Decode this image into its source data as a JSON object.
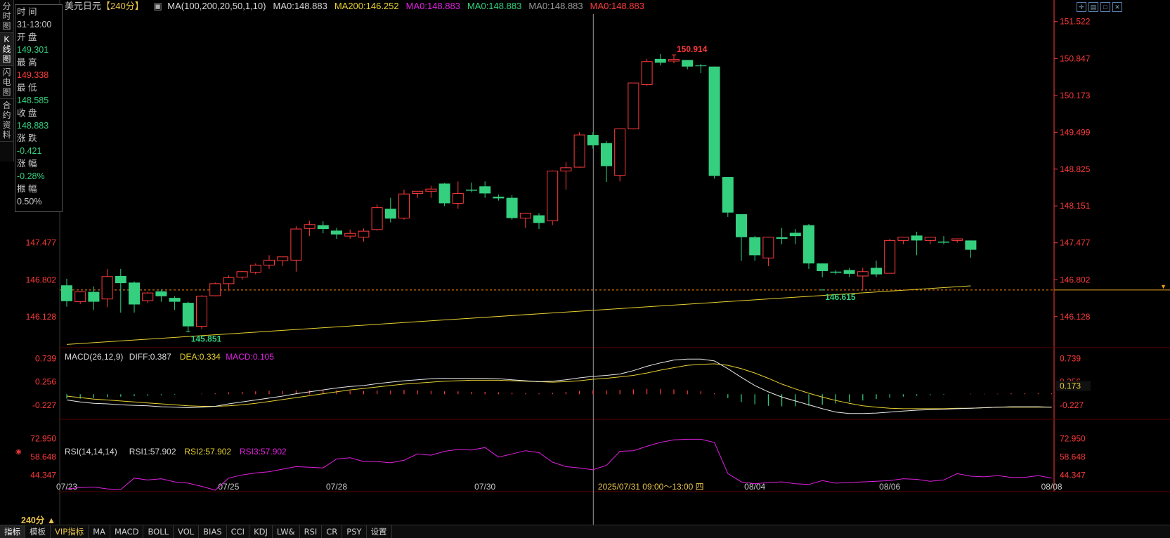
{
  "sidebar": {
    "items": [
      {
        "label": "分时图",
        "active": false
      },
      {
        "label": "K线图",
        "active": true
      },
      {
        "label": "闪电图",
        "active": false
      },
      {
        "label": "合约资料",
        "active": false
      }
    ]
  },
  "infobox": {
    "fields": [
      {
        "label": "时 间",
        "value": "31-13:00",
        "color": "#c8c8c8"
      },
      {
        "label": "开 盘",
        "value": "149.301",
        "color": "#35d07f"
      },
      {
        "label": "最 高",
        "value": "149.338",
        "color": "#ff3b3b"
      },
      {
        "label": "最 低",
        "value": "148.585",
        "color": "#35d07f"
      },
      {
        "label": "收 盘",
        "value": "148.883",
        "color": "#35d07f"
      },
      {
        "label": "涨 跌",
        "value": "-0.421",
        "color": "#35d07f"
      },
      {
        "label": "涨 幅",
        "value": "-0.28%",
        "color": "#35d07f"
      },
      {
        "label": "振 幅",
        "value": "0.50%",
        "color": "#c8c8c8"
      }
    ]
  },
  "header": {
    "symbol": "美元日元",
    "period": "【240分】",
    "items": [
      {
        "text": "MA(100,200,20,50,1,10)",
        "color": "#d8d8d8"
      },
      {
        "text": "MA0:148.883",
        "color": "#d8d8d8"
      },
      {
        "text": "MA200:146.252",
        "color": "#e8d030"
      },
      {
        "text": "MA0:148.883",
        "color": "#e020e0"
      },
      {
        "text": "MA0:148.883",
        "color": "#35d07f"
      },
      {
        "text": "MA0:148.883",
        "color": "#9a9a9a"
      },
      {
        "text": "MA0:148.883",
        "color": "#ff3b3b"
      }
    ]
  },
  "colors": {
    "up": "#ff3b3b",
    "down": "#35d07f",
    "ma200": "#e8d030",
    "grid": "#3a0000",
    "axis": "#ff3b3b"
  },
  "cursor_label": "2025/07/31 09:00～13:00 四",
  "period_label": "240分",
  "bottom_tabs": [
    "指标",
    "模板",
    "VIP指标",
    "MA",
    "MACD",
    "BOLL",
    "VOL",
    "BIAS",
    "CCI",
    "KDJ",
    "LW&",
    "RSI",
    "CR",
    "PSY",
    "设置"
  ],
  "chart_data": [
    {
      "type": "candlestick",
      "title": "美元日元",
      "y_ticks": [
        "151.522",
        "150.847",
        "150.173",
        "149.499",
        "148.825",
        "148.151",
        "147.477",
        "146.802",
        "146.128"
      ],
      "ylim": [
        145.56,
        151.66
      ],
      "x_ticks": [
        {
          "label": "07/23",
          "index": 0
        },
        {
          "label": "07/25",
          "index": 12
        },
        {
          "label": "07/28",
          "index": 20
        },
        {
          "label": "07/30",
          "index": 31
        },
        {
          "label": "08/04",
          "index": 51
        },
        {
          "label": "08/06",
          "index": 61
        },
        {
          "label": "08/08",
          "index": 73
        }
      ],
      "annotations": [
        {
          "text": "150.914",
          "index": 45,
          "value": 150.914,
          "color": "#ff3b3b"
        },
        {
          "text": "145.851",
          "index": 9,
          "value": 145.851,
          "color": "#35d07f"
        },
        {
          "text": "146.615",
          "index": 56,
          "value": 146.615,
          "color": "#35d07f"
        }
      ],
      "current_price_line": 146.615,
      "cursor_index": 39,
      "ohlc": [
        [
          146.7,
          146.82,
          146.41,
          146.31
        ],
        [
          146.4,
          146.59,
          146.58,
          146.36
        ],
        [
          146.58,
          146.68,
          146.4,
          146.25
        ],
        [
          146.45,
          147.0,
          146.86,
          146.3
        ],
        [
          146.87,
          147.0,
          146.74,
          146.2
        ],
        [
          146.75,
          146.77,
          146.35,
          146.2
        ],
        [
          146.42,
          146.58,
          146.56,
          146.38
        ],
        [
          146.59,
          146.62,
          146.5,
          146.4
        ],
        [
          146.47,
          146.5,
          146.4,
          146.25
        ],
        [
          146.38,
          146.4,
          145.95,
          145.85
        ],
        [
          145.95,
          146.52,
          146.5,
          145.9
        ],
        [
          146.51,
          146.75,
          146.73,
          146.5
        ],
        [
          146.73,
          146.88,
          146.84,
          146.6
        ],
        [
          146.85,
          146.96,
          146.95,
          146.8
        ],
        [
          146.94,
          147.1,
          147.07,
          146.9
        ],
        [
          147.07,
          147.25,
          147.16,
          147.0
        ],
        [
          147.15,
          147.22,
          147.22,
          147.05
        ],
        [
          147.16,
          147.78,
          147.73,
          146.95
        ],
        [
          147.74,
          147.88,
          147.81,
          147.6
        ],
        [
          147.8,
          147.87,
          147.73,
          147.65
        ],
        [
          147.7,
          147.75,
          147.63,
          147.55
        ],
        [
          147.6,
          147.72,
          147.65,
          147.55
        ],
        [
          147.58,
          147.74,
          147.69,
          147.5
        ],
        [
          147.72,
          148.18,
          148.12,
          147.7
        ],
        [
          148.1,
          148.3,
          147.92,
          147.85
        ],
        [
          147.93,
          148.45,
          148.37,
          147.9
        ],
        [
          148.38,
          148.42,
          148.42,
          148.3
        ],
        [
          148.42,
          148.52,
          148.46,
          148.3
        ],
        [
          148.56,
          148.57,
          148.2,
          148.15
        ],
        [
          148.2,
          148.6,
          148.38,
          148.1
        ],
        [
          148.45,
          148.58,
          148.43,
          148.4
        ],
        [
          148.51,
          148.6,
          148.38,
          148.3
        ],
        [
          148.32,
          148.36,
          148.29,
          148.25
        ],
        [
          148.3,
          148.35,
          147.93,
          147.9
        ],
        [
          147.93,
          148.02,
          148.02,
          147.75
        ],
        [
          147.98,
          148.02,
          147.84,
          147.73
        ],
        [
          147.88,
          148.8,
          148.79,
          147.8
        ],
        [
          148.79,
          148.95,
          148.85,
          148.45
        ],
        [
          148.86,
          149.5,
          149.45,
          148.85
        ],
        [
          149.45,
          149.5,
          149.26,
          149.2
        ],
        [
          149.3,
          149.34,
          148.88,
          148.59
        ],
        [
          148.71,
          149.53,
          149.56,
          148.6
        ],
        [
          149.56,
          150.4,
          150.4,
          149.55
        ],
        [
          150.37,
          150.84,
          150.79,
          150.35
        ],
        [
          150.84,
          150.93,
          150.77,
          150.72
        ],
        [
          150.8,
          150.91,
          150.83,
          150.76
        ],
        [
          150.82,
          150.82,
          150.7,
          150.65
        ],
        [
          150.72,
          150.75,
          150.71,
          150.58
        ],
        [
          150.7,
          150.7,
          148.7,
          148.65
        ],
        [
          148.68,
          148.68,
          148.03,
          147.95
        ],
        [
          148.0,
          148.0,
          147.58,
          147.15
        ],
        [
          147.58,
          147.6,
          147.25,
          147.15
        ],
        [
          147.2,
          147.58,
          147.58,
          147.05
        ],
        [
          147.58,
          147.75,
          147.55,
          147.45
        ],
        [
          147.66,
          147.73,
          147.6,
          147.45
        ],
        [
          147.8,
          147.82,
          147.1,
          147.0
        ],
        [
          147.1,
          147.1,
          146.96,
          146.85
        ],
        [
          146.95,
          146.98,
          146.93,
          146.9
        ],
        [
          146.98,
          147.02,
          146.91,
          146.85
        ],
        [
          146.87,
          147.02,
          146.95,
          146.62
        ],
        [
          147.02,
          147.15,
          146.9,
          146.85
        ],
        [
          146.92,
          147.55,
          147.52,
          146.92
        ],
        [
          147.52,
          147.58,
          147.58,
          147.45
        ],
        [
          147.61,
          147.68,
          147.52,
          147.25
        ],
        [
          147.52,
          147.58,
          147.58,
          147.45
        ],
        [
          147.5,
          147.6,
          147.48,
          147.45
        ],
        [
          147.52,
          147.55,
          147.55,
          147.48
        ],
        [
          147.52,
          147.52,
          147.35,
          147.2
        ]
      ],
      "ma200": {
        "name": "MA200",
        "start": 145.62,
        "end": 146.69
      }
    },
    {
      "type": "bar",
      "title": "MACD(26,12,9)",
      "legend": [
        {
          "text": "MACD(26,12,9)",
          "color": "#d8d8d8"
        },
        {
          "text": "DIFF:0.387",
          "color": "#d8d8d8"
        },
        {
          "text": "DEA:0.334",
          "color": "#e8d030"
        },
        {
          "text": "MACD:0.105",
          "color": "#e020e0"
        }
      ],
      "y_ticks": [
        "0.739",
        "0.256",
        "-0.227"
      ],
      "ylim": [
        -0.52,
        0.82
      ],
      "current_value": "0.173",
      "hist": [
        -0.09,
        -0.09,
        -0.08,
        -0.06,
        -0.05,
        -0.04,
        -0.03,
        -0.02,
        -0.01,
        0.0,
        0.01,
        0.02,
        0.04,
        0.05,
        0.06,
        0.07,
        0.07,
        0.08,
        0.08,
        0.08,
        0.08,
        0.07,
        0.07,
        0.08,
        0.08,
        0.09,
        0.08,
        0.07,
        0.06,
        0.06,
        0.05,
        0.05,
        0.04,
        0.03,
        0.02,
        0.02,
        0.03,
        0.05,
        0.07,
        0.08,
        0.08,
        0.09,
        0.1,
        0.11,
        0.11,
        0.1,
        0.08,
        0.06,
        0.02,
        -0.08,
        -0.16,
        -0.21,
        -0.24,
        -0.25,
        -0.25,
        -0.24,
        -0.22,
        -0.19,
        -0.16,
        -0.13,
        -0.1,
        -0.07,
        -0.05,
        -0.03,
        -0.02,
        -0.01,
        0.0,
        0.01,
        0.01,
        0.01,
        0.02,
        0.02,
        0.02,
        0.02
      ],
      "diff": [
        -0.12,
        -0.16,
        -0.19,
        -0.2,
        -0.22,
        -0.23,
        -0.24,
        -0.26,
        -0.27,
        -0.28,
        -0.27,
        -0.25,
        -0.2,
        -0.16,
        -0.12,
        -0.08,
        -0.04,
        0.01,
        0.05,
        0.09,
        0.13,
        0.16,
        0.18,
        0.22,
        0.25,
        0.28,
        0.3,
        0.32,
        0.33,
        0.33,
        0.33,
        0.33,
        0.32,
        0.3,
        0.28,
        0.26,
        0.27,
        0.3,
        0.34,
        0.37,
        0.39,
        0.42,
        0.49,
        0.58,
        0.65,
        0.71,
        0.73,
        0.73,
        0.69,
        0.53,
        0.35,
        0.18,
        0.05,
        -0.06,
        -0.14,
        -0.22,
        -0.3,
        -0.37,
        -0.4,
        -0.4,
        -0.39,
        -0.37,
        -0.35,
        -0.33,
        -0.32,
        -0.31,
        -0.3,
        -0.29,
        -0.28,
        -0.27,
        -0.26,
        -0.26,
        -0.26,
        -0.27
      ],
      "dea": [
        -0.04,
        -0.07,
        -0.1,
        -0.12,
        -0.14,
        -0.16,
        -0.18,
        -0.2,
        -0.22,
        -0.24,
        -0.25,
        -0.25,
        -0.24,
        -0.22,
        -0.19,
        -0.15,
        -0.11,
        -0.07,
        -0.03,
        0.01,
        0.05,
        0.09,
        0.12,
        0.15,
        0.18,
        0.21,
        0.23,
        0.25,
        0.27,
        0.28,
        0.29,
        0.29,
        0.29,
        0.28,
        0.27,
        0.26,
        0.25,
        0.26,
        0.28,
        0.31,
        0.33,
        0.36,
        0.39,
        0.44,
        0.5,
        0.55,
        0.6,
        0.62,
        0.63,
        0.6,
        0.53,
        0.44,
        0.33,
        0.21,
        0.11,
        0.02,
        -0.06,
        -0.13,
        -0.19,
        -0.24,
        -0.27,
        -0.29,
        -0.3,
        -0.3,
        -0.3,
        -0.3,
        -0.29,
        -0.29,
        -0.28,
        -0.27,
        -0.27,
        -0.27,
        -0.27,
        -0.27
      ]
    },
    {
      "type": "line",
      "title": "RSI(14,14,14)",
      "legend": [
        {
          "text": "RSI(14,14,14)",
          "color": "#d8d8d8"
        },
        {
          "text": "RSI1:57.902",
          "color": "#d8d8d8"
        },
        {
          "text": "RSI2:57.902",
          "color": "#e8d030"
        },
        {
          "text": "RSI3:57.902",
          "color": "#e020e0"
        }
      ],
      "y_ticks": [
        "72.950",
        "58.648",
        "44.347"
      ],
      "ylim": [
        33,
        81
      ],
      "rsi": [
        33.5,
        34.5,
        35.0,
        33.5,
        33.0,
        42.0,
        40.5,
        41.5,
        39.0,
        38.0,
        35.5,
        32.5,
        42.0,
        44.5,
        46.0,
        47.0,
        49.0,
        51.0,
        50.5,
        50.0,
        57.0,
        58.0,
        55.0,
        55.0,
        54.0,
        56.0,
        61.0,
        60.0,
        63.0,
        64.5,
        64.0,
        66.0,
        58.5,
        61.0,
        63.5,
        62.0,
        54.5,
        51.0,
        50.0,
        48.5,
        52.0,
        63.0,
        63.5,
        67.0,
        70.0,
        72.0,
        72.5,
        72.5,
        70.0,
        45.5,
        39.0,
        37.5,
        38.5,
        39.0,
        37.5,
        37.0,
        40.0,
        38.0,
        38.5,
        39.0,
        39.5,
        40.0,
        41.5,
        41.0,
        39.5,
        40.5,
        45.5,
        43.5,
        43.0,
        44.0,
        42.5,
        42.5,
        44.0,
        42.0
      ]
    }
  ]
}
